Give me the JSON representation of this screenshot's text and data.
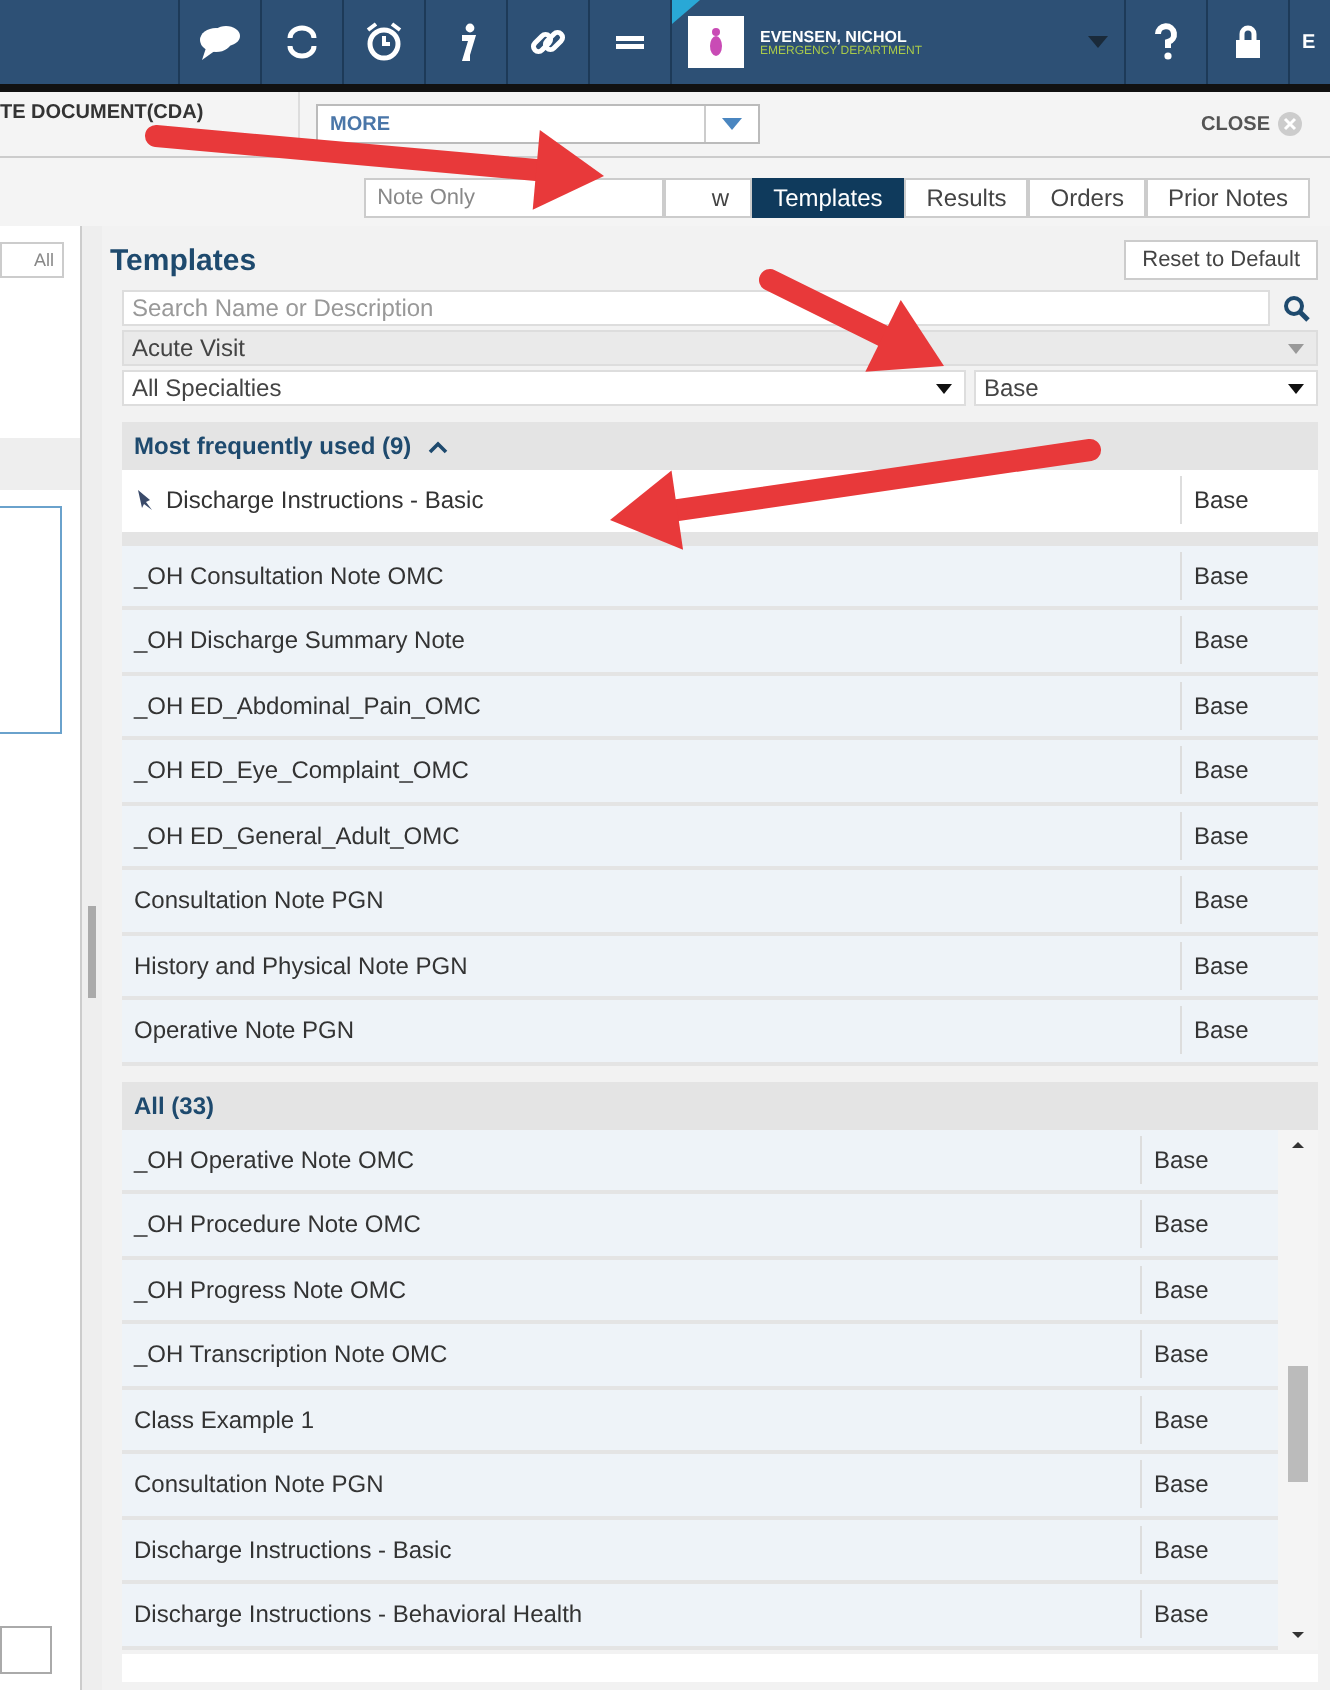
{
  "toolbar": {
    "patient_name": "EVENSEN, NICHOL",
    "patient_location": "EMERGENCY DEPARTMENT",
    "edge_label": "E"
  },
  "document_bar": {
    "title": "TE DOCUMENT(CDA)",
    "dropdown": "MORE",
    "close": "CLOSE"
  },
  "tabs": [
    {
      "label": "Note Only",
      "selected": false
    },
    {
      "label": "w",
      "selected": false
    },
    {
      "label": "Templates",
      "selected": true
    },
    {
      "label": "Results",
      "selected": false
    },
    {
      "label": "Orders",
      "selected": false
    },
    {
      "label": "Prior Notes",
      "selected": false
    }
  ],
  "left_panel": {
    "button": "All"
  },
  "templates": {
    "title": "Templates",
    "reset_button": "Reset to Default",
    "search_placeholder": "Search Name or Description",
    "encounter": "Acute Visit",
    "specialty": "All Specialties",
    "type": "Base",
    "groups": [
      {
        "label": "Most frequently used (9)",
        "collapsible": true,
        "scrollable": false,
        "rows": [
          {
            "name": "Discharge Instructions - Basic",
            "type": "Base",
            "pinned": true
          },
          {
            "name": "_OH Consultation Note OMC",
            "type": "Base",
            "pinned": false
          },
          {
            "name": "_OH Discharge Summary Note",
            "type": "Base",
            "pinned": false
          },
          {
            "name": "_OH ED_Abdominal_Pain_OMC",
            "type": "Base",
            "pinned": false
          },
          {
            "name": "_OH ED_Eye_Complaint_OMC",
            "type": "Base",
            "pinned": false
          },
          {
            "name": "_OH ED_General_Adult_OMC",
            "type": "Base",
            "pinned": false
          },
          {
            "name": "Consultation Note PGN",
            "type": "Base",
            "pinned": false
          },
          {
            "name": "History and Physical Note PGN",
            "type": "Base",
            "pinned": false
          },
          {
            "name": "Operative Note PGN",
            "type": "Base",
            "pinned": false
          }
        ]
      },
      {
        "label": "All (33)",
        "collapsible": false,
        "scrollable": true,
        "rows": [
          {
            "name": "_OH Operative Note OMC",
            "type": "Base",
            "pinned": false
          },
          {
            "name": "_OH Procedure Note OMC",
            "type": "Base",
            "pinned": false
          },
          {
            "name": "_OH Progress Note OMC",
            "type": "Base",
            "pinned": false
          },
          {
            "name": "_OH Transcription Note OMC",
            "type": "Base",
            "pinned": false
          },
          {
            "name": "Class Example 1",
            "type": "Base",
            "pinned": false
          },
          {
            "name": "Consultation Note PGN",
            "type": "Base",
            "pinned": false
          },
          {
            "name": "Discharge Instructions - Basic",
            "type": "Base",
            "pinned": false
          },
          {
            "name": "Discharge Instructions - Behavioral Health",
            "type": "Base",
            "pinned": false
          }
        ]
      }
    ]
  }
}
